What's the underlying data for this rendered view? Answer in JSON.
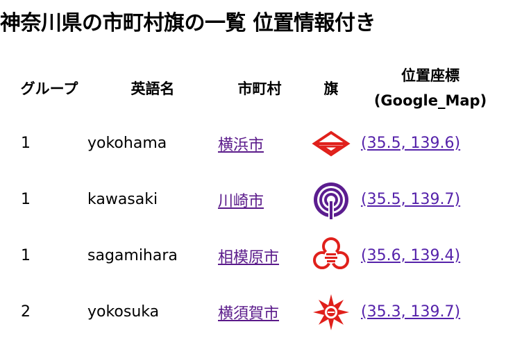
{
  "page": {
    "title": "神奈川県の市町村旗の一覧 位置情報付き"
  },
  "table": {
    "headers": {
      "group": "グループ",
      "english_name": "英語名",
      "municipality": "市町村",
      "flag": "旗",
      "coords_line1": "位置座標",
      "coords_line2": "(Google_Map)"
    },
    "rows": [
      {
        "group": "1",
        "english_name": "yokohama",
        "municipality": "横浜市",
        "flag_icon": "yokohama-flag-icon",
        "coords": "(35.5, 139.6)"
      },
      {
        "group": "1",
        "english_name": "kawasaki",
        "municipality": "川崎市",
        "flag_icon": "kawasaki-flag-icon",
        "coords": "(35.5, 139.7)"
      },
      {
        "group": "1",
        "english_name": "sagamihara",
        "municipality": "相模原市",
        "flag_icon": "sagamihara-flag-icon",
        "coords": "(35.6, 139.4)"
      },
      {
        "group": "2",
        "english_name": "yokosuka",
        "municipality": "横須賀市",
        "flag_icon": "yokosuka-flag-icon",
        "coords": "(35.3, 139.7)"
      }
    ]
  },
  "colors": {
    "link": "#5522aa",
    "yokohama_flag": "#e0201b",
    "kawasaki_flag": "#5b1d8f",
    "sagamihara_flag": "#e0201b",
    "yokosuka_flag": "#e0201b"
  }
}
